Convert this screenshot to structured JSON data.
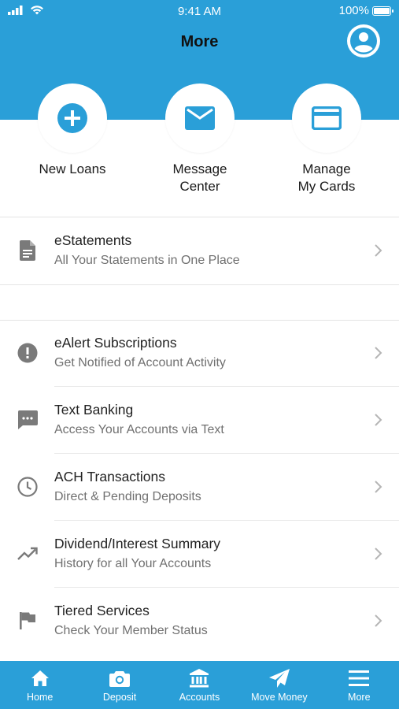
{
  "status_bar": {
    "time": "9:41 AM",
    "battery": "100%"
  },
  "header": {
    "title": "More"
  },
  "quick_actions": [
    {
      "label_line1": "New Loans",
      "label_line2": "",
      "icon": "plus-circle-icon"
    },
    {
      "label_line1": "Message",
      "label_line2": "Center",
      "icon": "envelope-icon"
    },
    {
      "label_line1": "Manage",
      "label_line2": "My Cards",
      "icon": "credit-card-icon"
    }
  ],
  "list": [
    {
      "title": "eStatements",
      "subtitle": "All Your Statements in One Place",
      "icon": "document-icon"
    },
    {
      "title": "eAlert Subscriptions",
      "subtitle": "Get Notified of Account Activity",
      "icon": "alert-circle-icon"
    },
    {
      "title": "Text Banking",
      "subtitle": "Access Your Accounts via Text",
      "icon": "chat-bubble-icon"
    },
    {
      "title": "ACH Transactions",
      "subtitle": "Direct & Pending Deposits",
      "icon": "clock-icon"
    },
    {
      "title": "Dividend/Interest Summary",
      "subtitle": "History for all Your Accounts",
      "icon": "trending-up-icon"
    },
    {
      "title": "Tiered Services",
      "subtitle": "Check Your Member Status",
      "icon": "flag-icon"
    }
  ],
  "tab_bar": {
    "active": "More",
    "tabs": [
      {
        "label": "Home",
        "icon": "home-icon"
      },
      {
        "label": "Deposit",
        "icon": "camera-icon"
      },
      {
        "label": "Accounts",
        "icon": "bank-icon"
      },
      {
        "label": "Move Money",
        "icon": "paper-plane-icon"
      },
      {
        "label": "More",
        "icon": "hamburger-menu-icon"
      }
    ]
  },
  "colors": {
    "brand": "#2a9fd8",
    "icon_gray": "#7a7a7a",
    "text_secondary": "#707070"
  }
}
